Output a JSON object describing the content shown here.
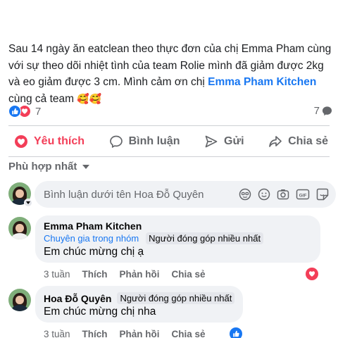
{
  "post": {
    "text_before": "Sau 14 ngày ăn eatclean theo thực đơn của chị Emma Pham cùng với sự theo dõi nhiệt tình của team Rolie mình đã giảm được 2kg và eo giảm được 3 cm. Mình cảm ơn chị ",
    "link_text": "Emma Pham Kitchen",
    "text_after": " cùng cả team ",
    "emoji": "🥰🥰",
    "reaction_count": "7",
    "comment_count": "7"
  },
  "actions": {
    "like_label": "Yêu thích",
    "comment_label": "Bình luận",
    "send_label": "Gửi",
    "share_label": "Chia sẻ"
  },
  "sort": {
    "label": "Phù hợp nhất"
  },
  "composer": {
    "placeholder": "Bình luận dưới tên Hoa Đỗ Quyên"
  },
  "comments": [
    {
      "author": "Emma Pham Kitchen",
      "badges": [
        "Chuyên gia trong nhóm",
        "Người đóng góp nhiều nhất"
      ],
      "text": "Em chúc mừng chị ạ",
      "time": "3 tuần",
      "like": "Thích",
      "reply": "Phản hồi",
      "share": "Chia sẻ",
      "reaction": "love"
    },
    {
      "author": "Hoa Đỗ Quyên",
      "badges": [
        "Người đóng góp nhiều nhất"
      ],
      "text": "Em chúc mừng chị nha",
      "time": "3 tuần",
      "like": "Thích",
      "reply": "Phản hồi",
      "share": "Chia sẻ",
      "reaction": "like"
    }
  ],
  "colors": {
    "accent": "#1877f2",
    "love": "#f33e58",
    "muted": "#65676b",
    "bubble": "#f0f2f5"
  }
}
